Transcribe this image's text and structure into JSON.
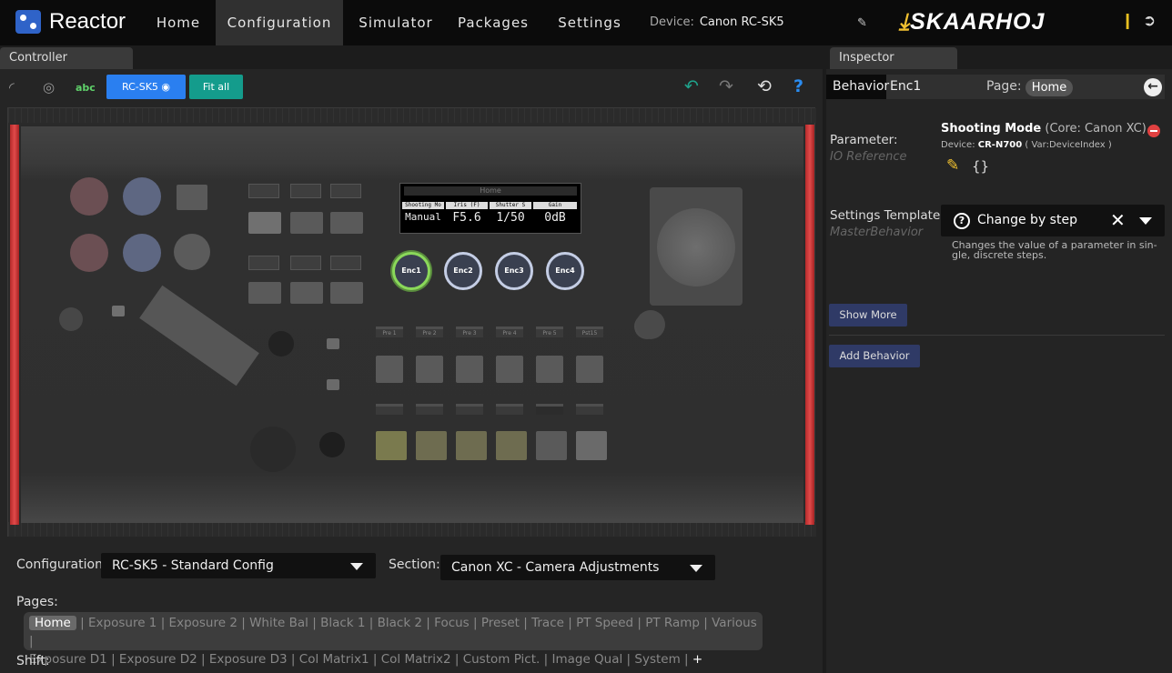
{
  "app": {
    "name": "Reactor",
    "brand": "SKAARHOJ"
  },
  "nav": {
    "items": [
      "Home",
      "Configuration",
      "Simulator",
      "Packages",
      "Settings"
    ],
    "active": "Configuration"
  },
  "device": {
    "label": "Device:",
    "name": "Canon RC-SK5"
  },
  "panes": {
    "controller": "Controller",
    "inspector": "Inspector"
  },
  "toolbar": {
    "text_toggle": "abc",
    "model_button": "RC-SK5",
    "fit_all": "Fit all",
    "help": "?"
  },
  "oled": {
    "title": "Home",
    "headers": [
      "Shooting Mo",
      "Iris (F)",
      "Shutter S",
      "Gain"
    ],
    "values": [
      "Manual",
      "F5.6",
      "1/50",
      "0dB"
    ]
  },
  "encoders": [
    "Enc1",
    "Enc2",
    "Enc3",
    "Enc4"
  ],
  "preset_labels": [
    "Pre 1",
    "Pre 2",
    "Pre 3",
    "Pre 4",
    "Pre 5",
    "Pst15"
  ],
  "config": {
    "config_label": "Configuration:",
    "config_value": "RC-SK5 - Standard Config",
    "section_label": "Section:",
    "section_value": "Canon XC - Camera Adjustments",
    "pages_label": "Pages:",
    "shift_label": "Shift:",
    "pages_row1": [
      "Home",
      "Exposure 1",
      "Exposure 2",
      "White Bal",
      "Black 1",
      "Black 2",
      "Focus",
      "Preset",
      "Trace",
      "PT Speed",
      "PT Ramp",
      "Various"
    ],
    "pages_row2": [
      "Exposure D1",
      "Exposure D2",
      "Exposure D3",
      "Col Matrix1",
      "Col Matrix2",
      "Custom Pict.",
      "Image Qual",
      "System"
    ],
    "add_page": "+"
  },
  "inspector": {
    "tab_behavior": "Behavior",
    "tab_target": "Enc1",
    "page_label": "Page:",
    "page_value": "Home",
    "parameter_label": "Parameter:",
    "parameter_sub": "IO Reference",
    "param_name": "Shooting Mode",
    "param_core": "(Core: Canon XC)",
    "param_device_label": "Device:",
    "param_device": "CR-N700",
    "param_device_var": "( Var:DeviceIndex )",
    "braces": "{}",
    "settings_label": "Settings Template:",
    "settings_sub": "MasterBehavior",
    "template_value": "Change by step",
    "template_desc": "Changes the value of a parameter in sin-gle, discrete steps.",
    "show_more": "Show More",
    "add_behavior": "Add Behavior"
  }
}
